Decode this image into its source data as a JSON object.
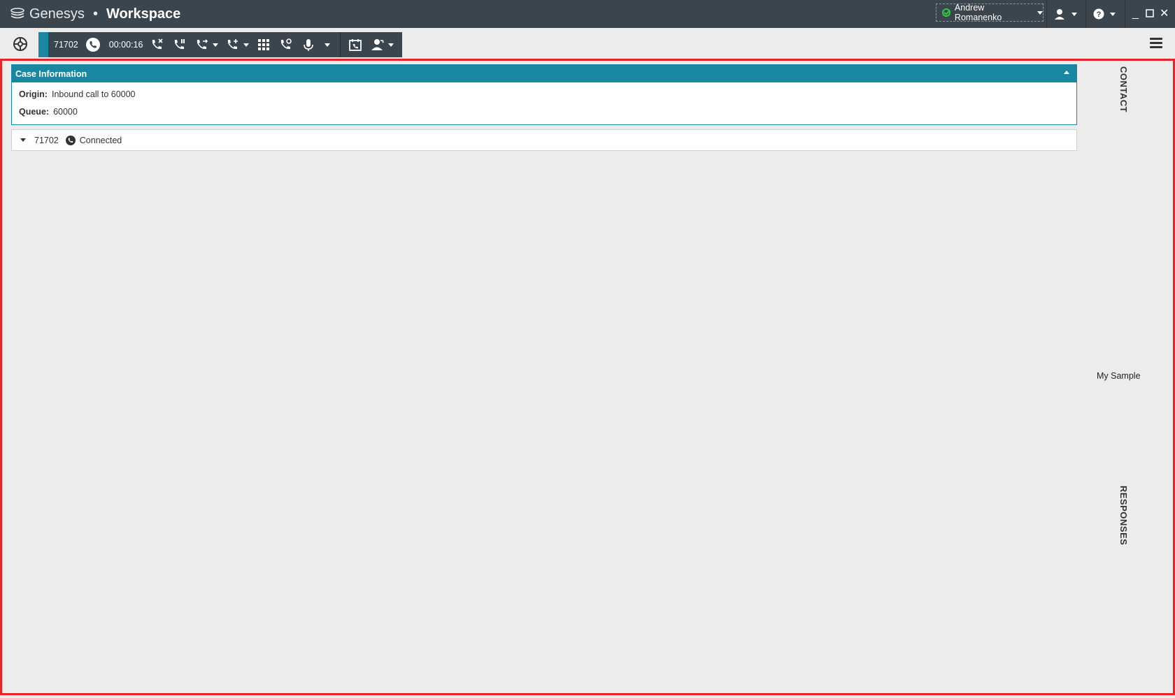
{
  "titlebar": {
    "brand": "Genesys",
    "separator": "•",
    "app": "Workspace",
    "user_name": "Andrew Romanenko",
    "status_color": "#2ecc40",
    "icons": [
      "genesys-logo-icon",
      "agent-status-icon",
      "help-icon",
      "minimize-icon",
      "maximize-icon",
      "close-icon"
    ]
  },
  "toolbar": {
    "call_number": "71702",
    "call_timer": "00:00:16",
    "icons": [
      "gear-icon",
      "phone-icon",
      "end-call-icon",
      "hold-call-icon",
      "transfer-call-icon",
      "conference-call-icon",
      "dialpad-icon",
      "voicemail-icon",
      "microphone-icon",
      "schedule-callback-icon",
      "consult-agent-icon",
      "hamburger-menu-icon"
    ]
  },
  "case_info": {
    "title": "Case Information",
    "origin_label": "Origin:",
    "origin_value": "Inbound call to 60000",
    "queue_label": "Queue:",
    "queue_value": "60000"
  },
  "connection": {
    "number": "71702",
    "status": "Connected"
  },
  "side_tabs": {
    "contact": "CONTACT",
    "responses": "RESPONSES"
  },
  "sample_label": "My Sample",
  "colors": {
    "titlebar": "#3b454d",
    "accent": "#1a87a0",
    "frame_border": "#e8232a"
  }
}
